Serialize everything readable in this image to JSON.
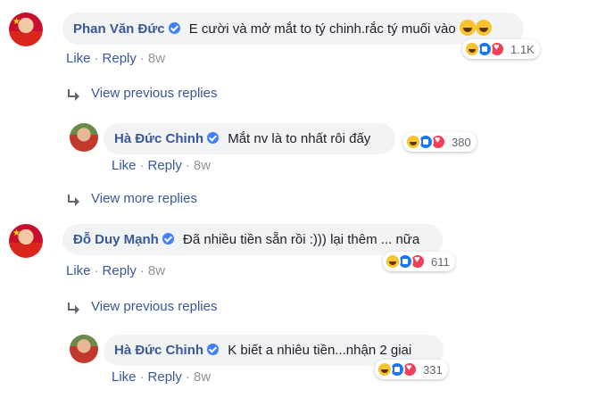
{
  "comments": [
    {
      "author": "Phan Văn Đức",
      "text": "E cười và mở mắt to tý chinh.rắc tý muối vào",
      "reactions_count": "1.1K",
      "like": "Like",
      "reply": "Reply",
      "time": "8w",
      "view_link": "View previous replies"
    },
    {
      "author": "Hà Đức Chinh",
      "text": "Mắt nv là to nhất rôi đấy",
      "reactions_count": "380",
      "like": "Like",
      "reply": "Reply",
      "time": "8w",
      "view_link": "View more replies"
    },
    {
      "author": "Đỗ Duy Mạnh",
      "text": "Đã nhiều tiền sẵn rồi :))) lại thêm ... nữa",
      "reactions_count": "611",
      "like": "Like",
      "reply": "Reply",
      "time": "8w",
      "view_link": "View previous replies"
    },
    {
      "author": "Hà Đức Chinh",
      "text": "K biết a nhiêu tiền...nhận 2 giai",
      "reactions_count": "331",
      "like": "Like",
      "reply": "Reply",
      "time": "8w"
    }
  ],
  "colors": {
    "link": "#385898",
    "bubble": "#f2f3f5",
    "meta": "#90949c"
  },
  "icons": [
    "verified-badge-icon",
    "haha-reaction-icon",
    "like-reaction-icon",
    "love-reaction-icon",
    "reply-arrow-icon"
  ]
}
